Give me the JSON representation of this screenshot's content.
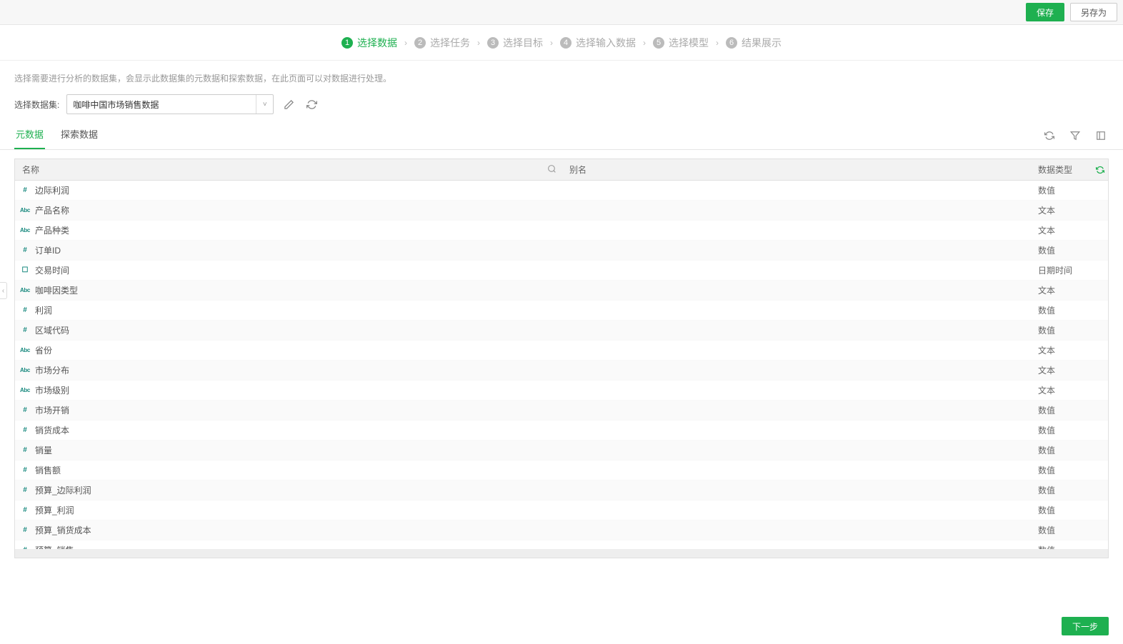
{
  "header": {
    "save_label": "保存",
    "save_as_label": "另存为"
  },
  "steps": [
    {
      "num": "1",
      "label": "选择数据",
      "active": true
    },
    {
      "num": "2",
      "label": "选择任务",
      "active": false
    },
    {
      "num": "3",
      "label": "选择目标",
      "active": false
    },
    {
      "num": "4",
      "label": "选择输入数据",
      "active": false
    },
    {
      "num": "5",
      "label": "选择模型",
      "active": false
    },
    {
      "num": "6",
      "label": "结果展示",
      "active": false
    }
  ],
  "description": "选择需要进行分析的数据集，会显示此数据集的元数据和探索数据，在此页面可以对数据进行处理。",
  "dataset": {
    "label": "选择数据集:",
    "value": "咖啡中国市场销售数据"
  },
  "tabs": {
    "metadata": "元数据",
    "explore": "探索数据"
  },
  "table": {
    "columns": {
      "name": "名称",
      "alias": "别名",
      "type": "数据类型"
    },
    "rows": [
      {
        "icon": "#",
        "icon_class": "ti-num",
        "name": "边际利润",
        "alias": "",
        "type": "数值"
      },
      {
        "icon": "Abc",
        "icon_class": "ti-abc",
        "name": "产品名称",
        "alias": "",
        "type": "文本"
      },
      {
        "icon": "Abc",
        "icon_class": "ti-abc",
        "name": "产品种类",
        "alias": "",
        "type": "文本"
      },
      {
        "icon": "#",
        "icon_class": "ti-num",
        "name": "订单ID",
        "alias": "",
        "type": "数值"
      },
      {
        "icon": "☐",
        "icon_class": "ti-date",
        "name": "交易时间",
        "alias": "",
        "type": "日期时间"
      },
      {
        "icon": "Abc",
        "icon_class": "ti-abc",
        "name": "咖啡因类型",
        "alias": "",
        "type": "文本"
      },
      {
        "icon": "#",
        "icon_class": "ti-num",
        "name": "利润",
        "alias": "",
        "type": "数值"
      },
      {
        "icon": "#",
        "icon_class": "ti-num",
        "name": "区域代码",
        "alias": "",
        "type": "数值"
      },
      {
        "icon": "Abc",
        "icon_class": "ti-abc",
        "name": "省份",
        "alias": "",
        "type": "文本"
      },
      {
        "icon": "Abc",
        "icon_class": "ti-abc",
        "name": "市场分布",
        "alias": "",
        "type": "文本"
      },
      {
        "icon": "Abc",
        "icon_class": "ti-abc",
        "name": "市场级别",
        "alias": "",
        "type": "文本"
      },
      {
        "icon": "#",
        "icon_class": "ti-num",
        "name": "市场开销",
        "alias": "",
        "type": "数值"
      },
      {
        "icon": "#",
        "icon_class": "ti-num",
        "name": "销货成本",
        "alias": "",
        "type": "数值"
      },
      {
        "icon": "#",
        "icon_class": "ti-num",
        "name": "销量",
        "alias": "",
        "type": "数值"
      },
      {
        "icon": "#",
        "icon_class": "ti-num",
        "name": "销售额",
        "alias": "",
        "type": "数值"
      },
      {
        "icon": "#",
        "icon_class": "ti-num",
        "name": "预算_边际利润",
        "alias": "",
        "type": "数值"
      },
      {
        "icon": "#",
        "icon_class": "ti-num",
        "name": "预算_利润",
        "alias": "",
        "type": "数值"
      },
      {
        "icon": "#",
        "icon_class": "ti-num",
        "name": "预算_销货成本",
        "alias": "",
        "type": "数值"
      },
      {
        "icon": "#",
        "icon_class": "ti-num",
        "name": "预算_销售",
        "alias": "",
        "type": "数值"
      }
    ]
  },
  "footer": {
    "next_label": "下一步"
  }
}
